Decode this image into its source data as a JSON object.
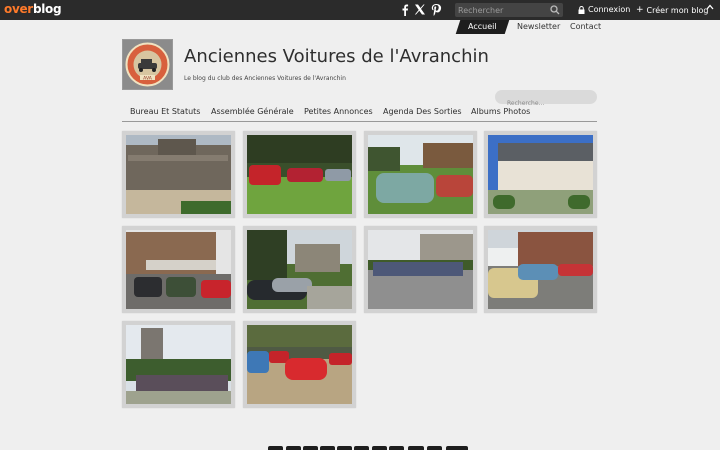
{
  "topbar": {
    "brand_o": "over",
    "brand_rest": "blog",
    "social_icons": [
      "facebook-icon",
      "x-icon",
      "pinterest-icon"
    ],
    "search_placeholder": "Rechercher",
    "login": "Connexion",
    "create_blog": "Créer mon blog"
  },
  "top_nav": {
    "accueil": "Accueil",
    "newsletter": "Newsletter",
    "contact": "Contact"
  },
  "header": {
    "title": "Anciennes Voitures de l'Avranchin",
    "description": "Le blog du club des Anciennes Voitures de l'Avranchin",
    "logo_text": "AVA",
    "search_placeholder": "Recherche..."
  },
  "main_menu": {
    "items": [
      "Bureau Et Statuts",
      "Assemblée Générale",
      "Petites Annonces",
      "Agenda Des Sorties",
      "Albums Photos"
    ]
  },
  "gallery": {
    "count": 10
  },
  "pagination": {
    "count": 10
  },
  "colors": {
    "topbar": "#2b2b2b",
    "brand_accent": "#ff7a2a",
    "background": "#efefef",
    "active_nav": "#1e1e1e"
  }
}
